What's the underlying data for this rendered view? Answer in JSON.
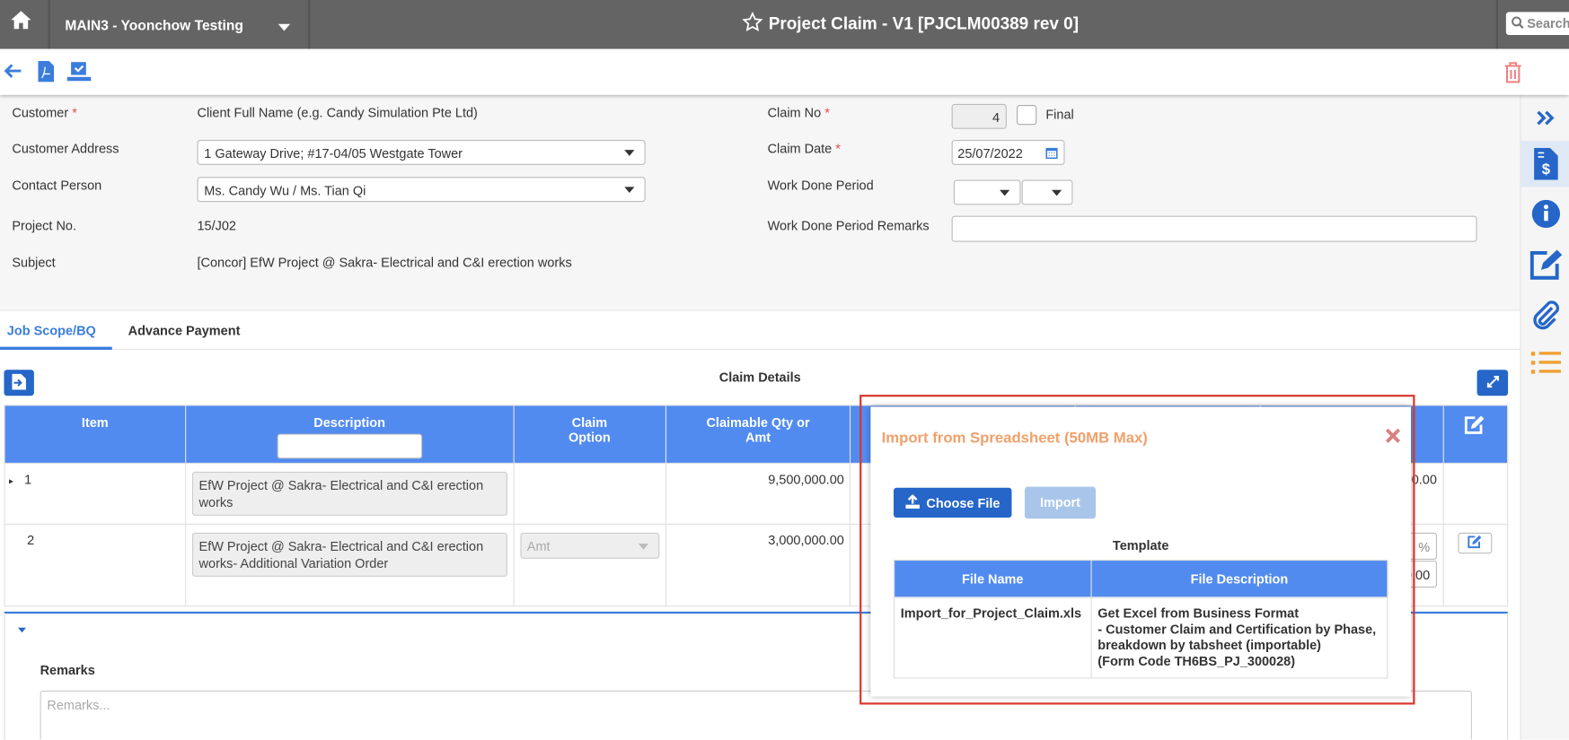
{
  "header": {
    "company": "MAIN3 - Yoonchow Testing",
    "title": "Project Claim - V1 [PJCLM00389 rev 0]",
    "search_placeholder": "Search"
  },
  "form": {
    "customer": {
      "label": "Customer",
      "value": "Client Full Name (e.g. Candy Simulation Pte Ltd)"
    },
    "customer_address": {
      "label": "Customer Address",
      "value": "1 Gateway Drive; #17-04/05 Westgate Tower"
    },
    "contact_person": {
      "label": "Contact Person",
      "value": "Ms. Candy Wu / Ms. Tian Qi"
    },
    "project_no": {
      "label": "Project No.",
      "value": "15/J02"
    },
    "subject": {
      "label": "Subject",
      "value": "[Concor] EfW Project @ Sakra- Electrical and C&I erection works"
    },
    "claim_no": {
      "label": "Claim No",
      "value": "4",
      "final_label": "Final",
      "final_checked": false
    },
    "claim_date": {
      "label": "Claim Date",
      "value": "25/07/2022"
    },
    "work_done_period": {
      "label": "Work Done Period"
    },
    "work_done_remarks": {
      "label": "Work Done Period Remarks",
      "value": ""
    },
    "required_mark": "*"
  },
  "tabs": [
    {
      "label": "Job Scope/BQ",
      "active": true
    },
    {
      "label": "Advance Payment",
      "active": false
    }
  ],
  "claim_details": {
    "title": "Claim Details",
    "columns": [
      "Item",
      "Description",
      "Claim Option",
      "Claimable Qty or Amt"
    ],
    "rows": [
      {
        "item": "1",
        "description": "EfW Project @ Sakra- Electrical and C&I erection works",
        "claim_option": "",
        "claimable": "9,500,000.00",
        "trailing": "00.00"
      },
      {
        "item": "2",
        "description": "EfW Project @ Sakra- Electrical and C&I erection works- Additional Variation Order",
        "claim_option": "Amt",
        "claimable": "3,000,000.00",
        "trailing_pct": "%",
        "trailing": "0.00"
      }
    ]
  },
  "remarks": {
    "label": "Remarks",
    "placeholder": "Remarks..."
  },
  "modal": {
    "title": "Import from Spreadsheet (50MB Max)",
    "choose_file": "Choose File",
    "import": "Import",
    "template_title": "Template",
    "columns": [
      "File Name",
      "File Description"
    ],
    "rows": [
      {
        "file_name": "Import_for_Project_Claim.xls",
        "description": [
          "Get Excel from Business Format",
          "- Customer Claim and Certification by Phase,",
          "breakdown by tabsheet (importable)",
          "(Form Code TH6BS_PJ_300028)"
        ]
      }
    ]
  },
  "colors": {
    "topbar": "#646464",
    "primary": "#2566c8",
    "table_header": "#518bf0",
    "modal_title": "#f0a06a",
    "highlight": "#d9382c"
  }
}
